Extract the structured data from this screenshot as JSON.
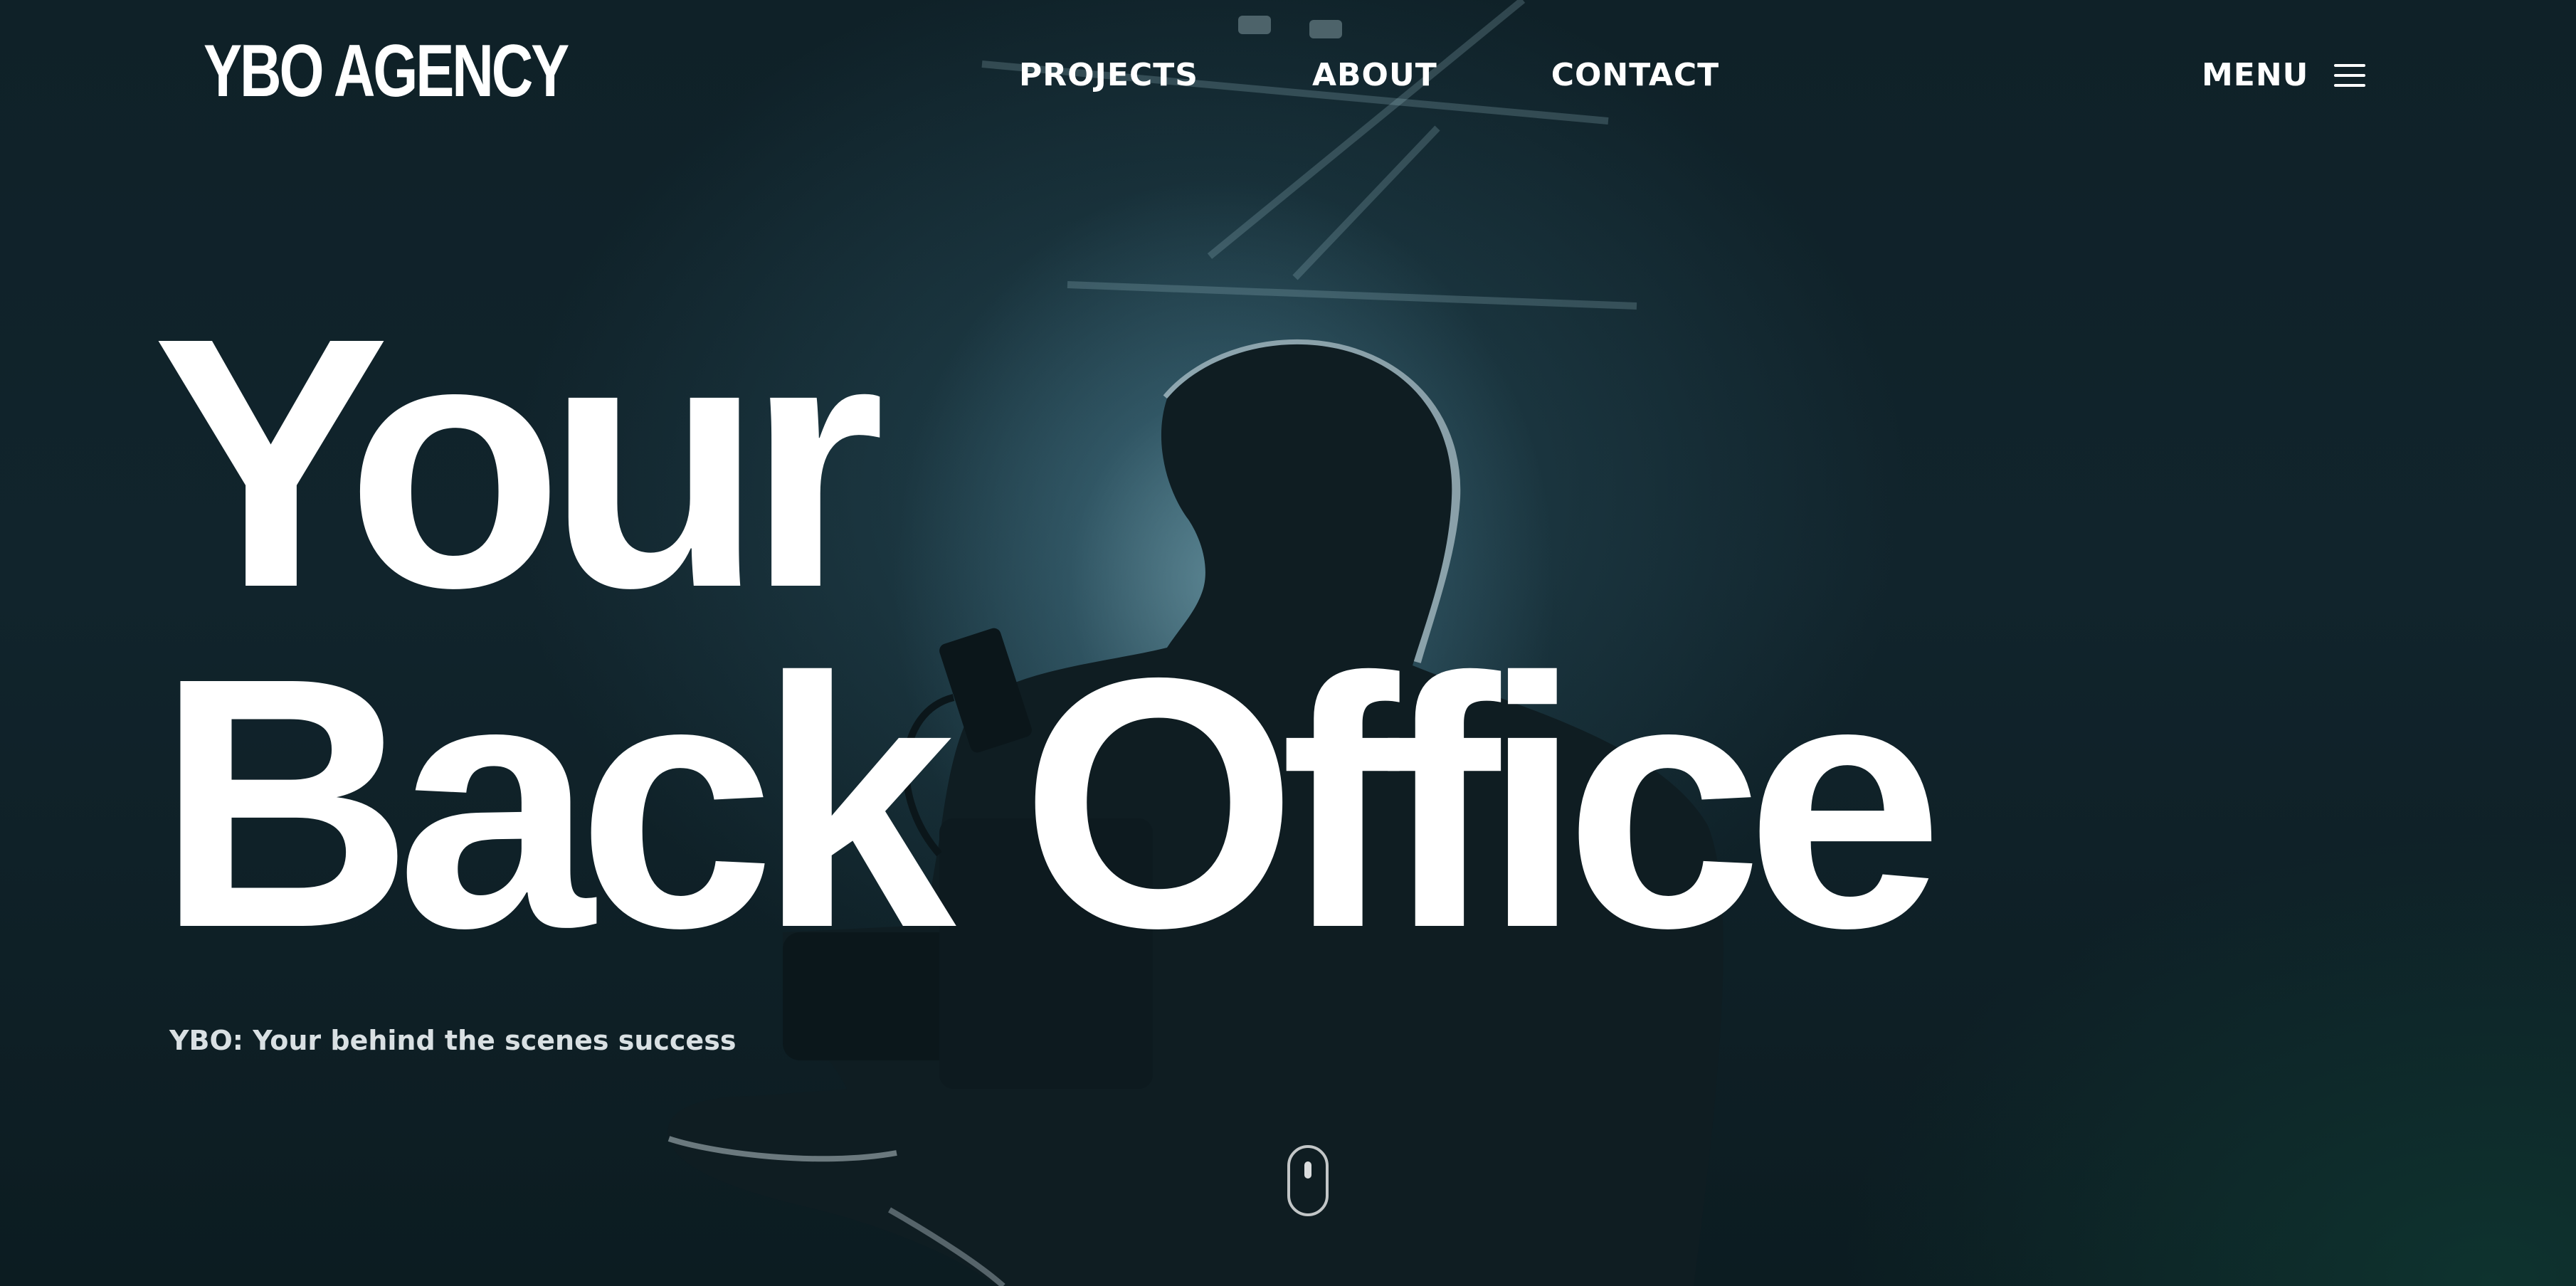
{
  "header": {
    "logo_text": "YBO AGENCY",
    "nav": [
      {
        "label": "PROJECTS"
      },
      {
        "label": "ABOUT"
      },
      {
        "label": "CONTACT"
      }
    ],
    "menu_label": "MENU",
    "menu_icon": "hamburger-icon"
  },
  "hero": {
    "line1": "Your",
    "line2": "Back Office",
    "tagline": "YBO: Your behind the scenes success",
    "scroll_icon": "mouse-scroll-icon",
    "background_image": "camera-operator-silhouette"
  },
  "colors": {
    "text": "#ffffff",
    "tagline": "#d9e0e3",
    "background": "#11242c",
    "backlight": "#8cbecd",
    "corner_tint": "#10463a"
  }
}
